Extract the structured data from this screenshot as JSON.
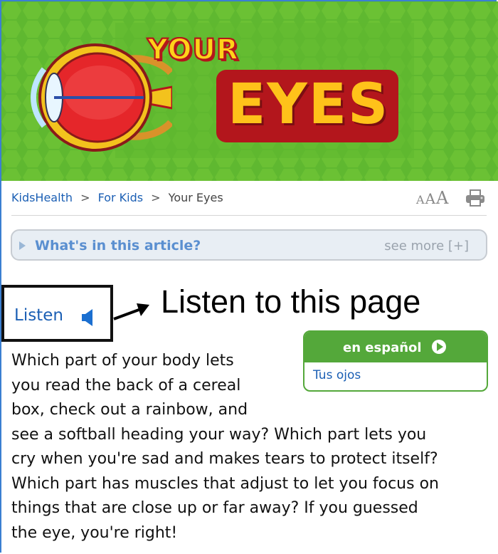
{
  "banner": {
    "title_top": "YOUR",
    "title_main": "EYES",
    "colors": {
      "background": "#5fb830",
      "hex": "#7ccf3a",
      "title_fill": "#ffc21a",
      "title_outline": "#b3161c"
    },
    "icons": [
      "eye-illustration"
    ]
  },
  "breadcrumb": {
    "home": "KidsHealth",
    "sep1": ">",
    "section": "For Kids",
    "sep2": ">",
    "current": "Your Eyes"
  },
  "text_size": {
    "small": "A",
    "medium": "A",
    "large": "A"
  },
  "toolbar": {
    "print_icon": "printer-icon"
  },
  "article_toggle": {
    "label": "What's in this article?",
    "see_more": "see more [+]"
  },
  "listen": {
    "label": "Listen",
    "icon": "speaker-icon",
    "annotation": "Listen to this page"
  },
  "spanish": {
    "header": "en español",
    "link": "Tus ojos",
    "color": "#54a83a"
  },
  "body": {
    "lines": [
      "Which part of your body lets",
      "you read the back of a cereal",
      "box, check out a rainbow, and",
      "see a softball heading your way? Which part lets you",
      "cry when you're sad and makes tears to protect itself?",
      "Which part has muscles that adjust to let you focus on",
      "things that are close up or far away? If you guessed",
      "the eye, you're right!"
    ]
  },
  "colors": {
    "link": "#1b5fb4",
    "frame": "#3b7fd1"
  }
}
